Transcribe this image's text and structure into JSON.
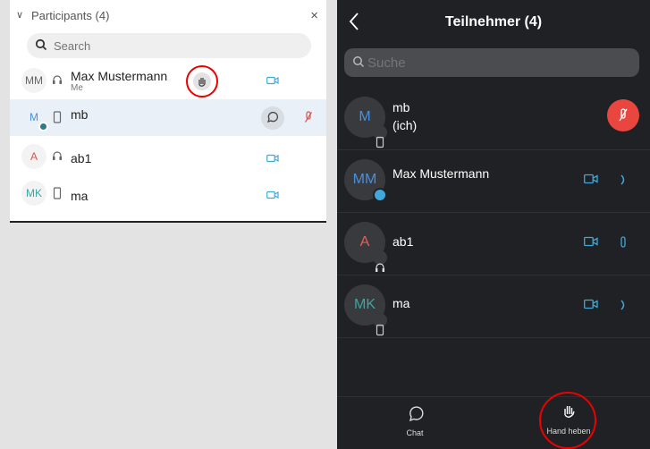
{
  "desktop": {
    "title": "Participants (4)",
    "search_placeholder": "Search",
    "participants": [
      {
        "initials": "MM",
        "name": "Max Mustermann",
        "sub": "Me"
      },
      {
        "initials": "M",
        "name": "mb",
        "sub": ""
      },
      {
        "initials": "A",
        "name": "ab1",
        "sub": ""
      },
      {
        "initials": "MK",
        "name": "ma",
        "sub": ""
      }
    ]
  },
  "mobile": {
    "title": "Teilnehmer (4)",
    "search_placeholder": "Suche",
    "participants": [
      {
        "initials": "M",
        "name": "mb",
        "sub": "(ich)"
      },
      {
        "initials": "MM",
        "name": "Max Mustermann",
        "sub": ""
      },
      {
        "initials": "A",
        "name": "ab1",
        "sub": ""
      },
      {
        "initials": "MK",
        "name": "ma",
        "sub": ""
      }
    ],
    "footer": {
      "chat_label": "Chat",
      "raise_hand_label": "Hand heben"
    }
  },
  "colors": {
    "accent": "#3fa9dc",
    "mute_red": "#e8463f",
    "highlight_ring": "#e00000"
  }
}
